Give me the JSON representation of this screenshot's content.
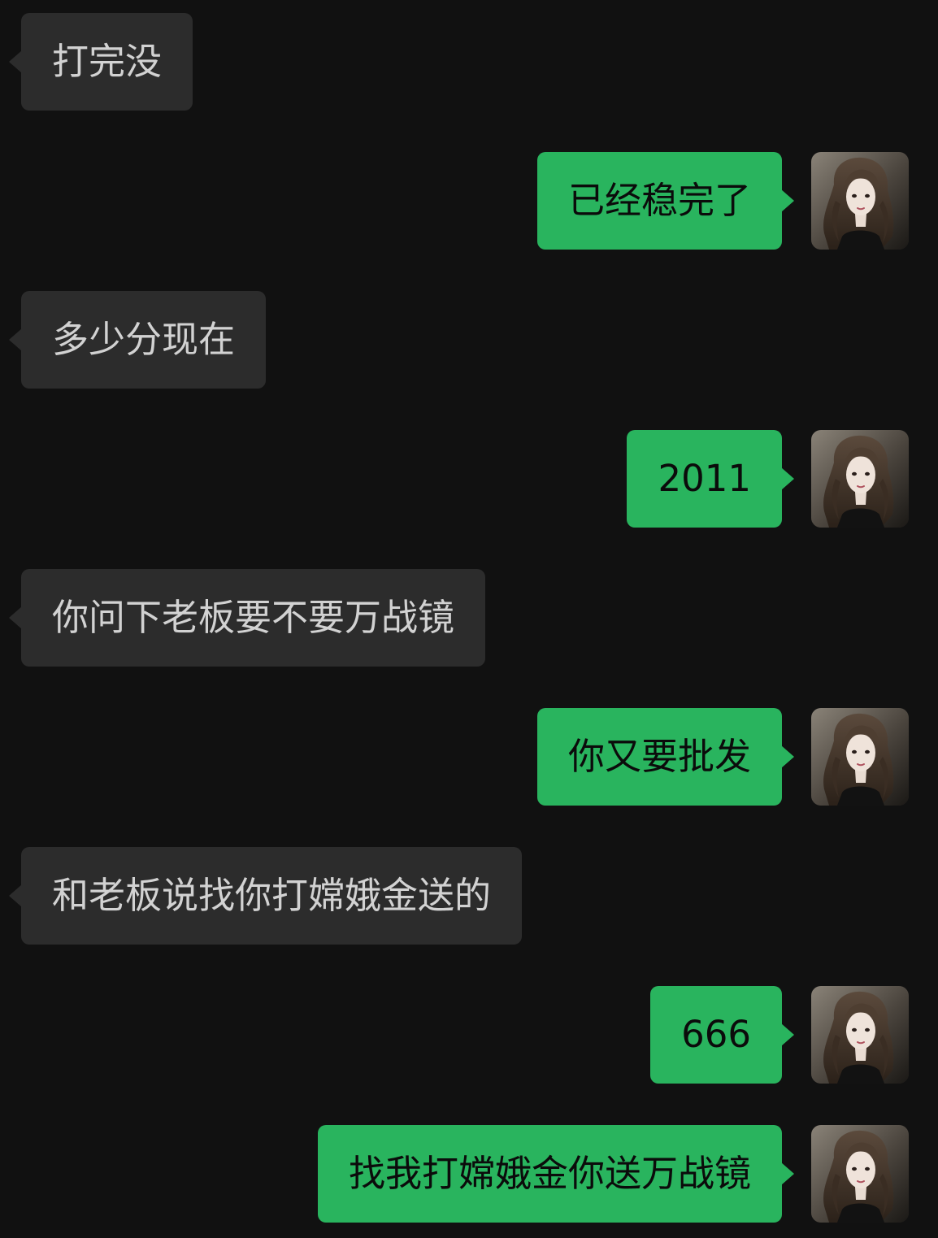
{
  "messages": [
    {
      "side": "in",
      "text": "打完没"
    },
    {
      "side": "out",
      "text": "已经稳完了",
      "avatar_icon": "user-avatar"
    },
    {
      "side": "in",
      "text": "多少分现在"
    },
    {
      "side": "out",
      "text": "2011",
      "avatar_icon": "user-avatar"
    },
    {
      "side": "in",
      "text": "你问下老板要不要万战镜"
    },
    {
      "side": "out",
      "text": "你又要批发",
      "avatar_icon": "user-avatar"
    },
    {
      "side": "in",
      "text": "和老板说找你打嫦娥金送的"
    },
    {
      "side": "out",
      "text": "666",
      "avatar_icon": "user-avatar"
    },
    {
      "side": "out",
      "text": "找我打嫦娥金你送万战镜",
      "avatar_icon": "user-avatar"
    }
  ],
  "colors": {
    "background": "#111111",
    "incoming_bubble": "#2c2c2c",
    "incoming_text": "#d2d2d2",
    "outgoing_bubble": "#29b45e",
    "outgoing_text": "#0b0b0b"
  }
}
